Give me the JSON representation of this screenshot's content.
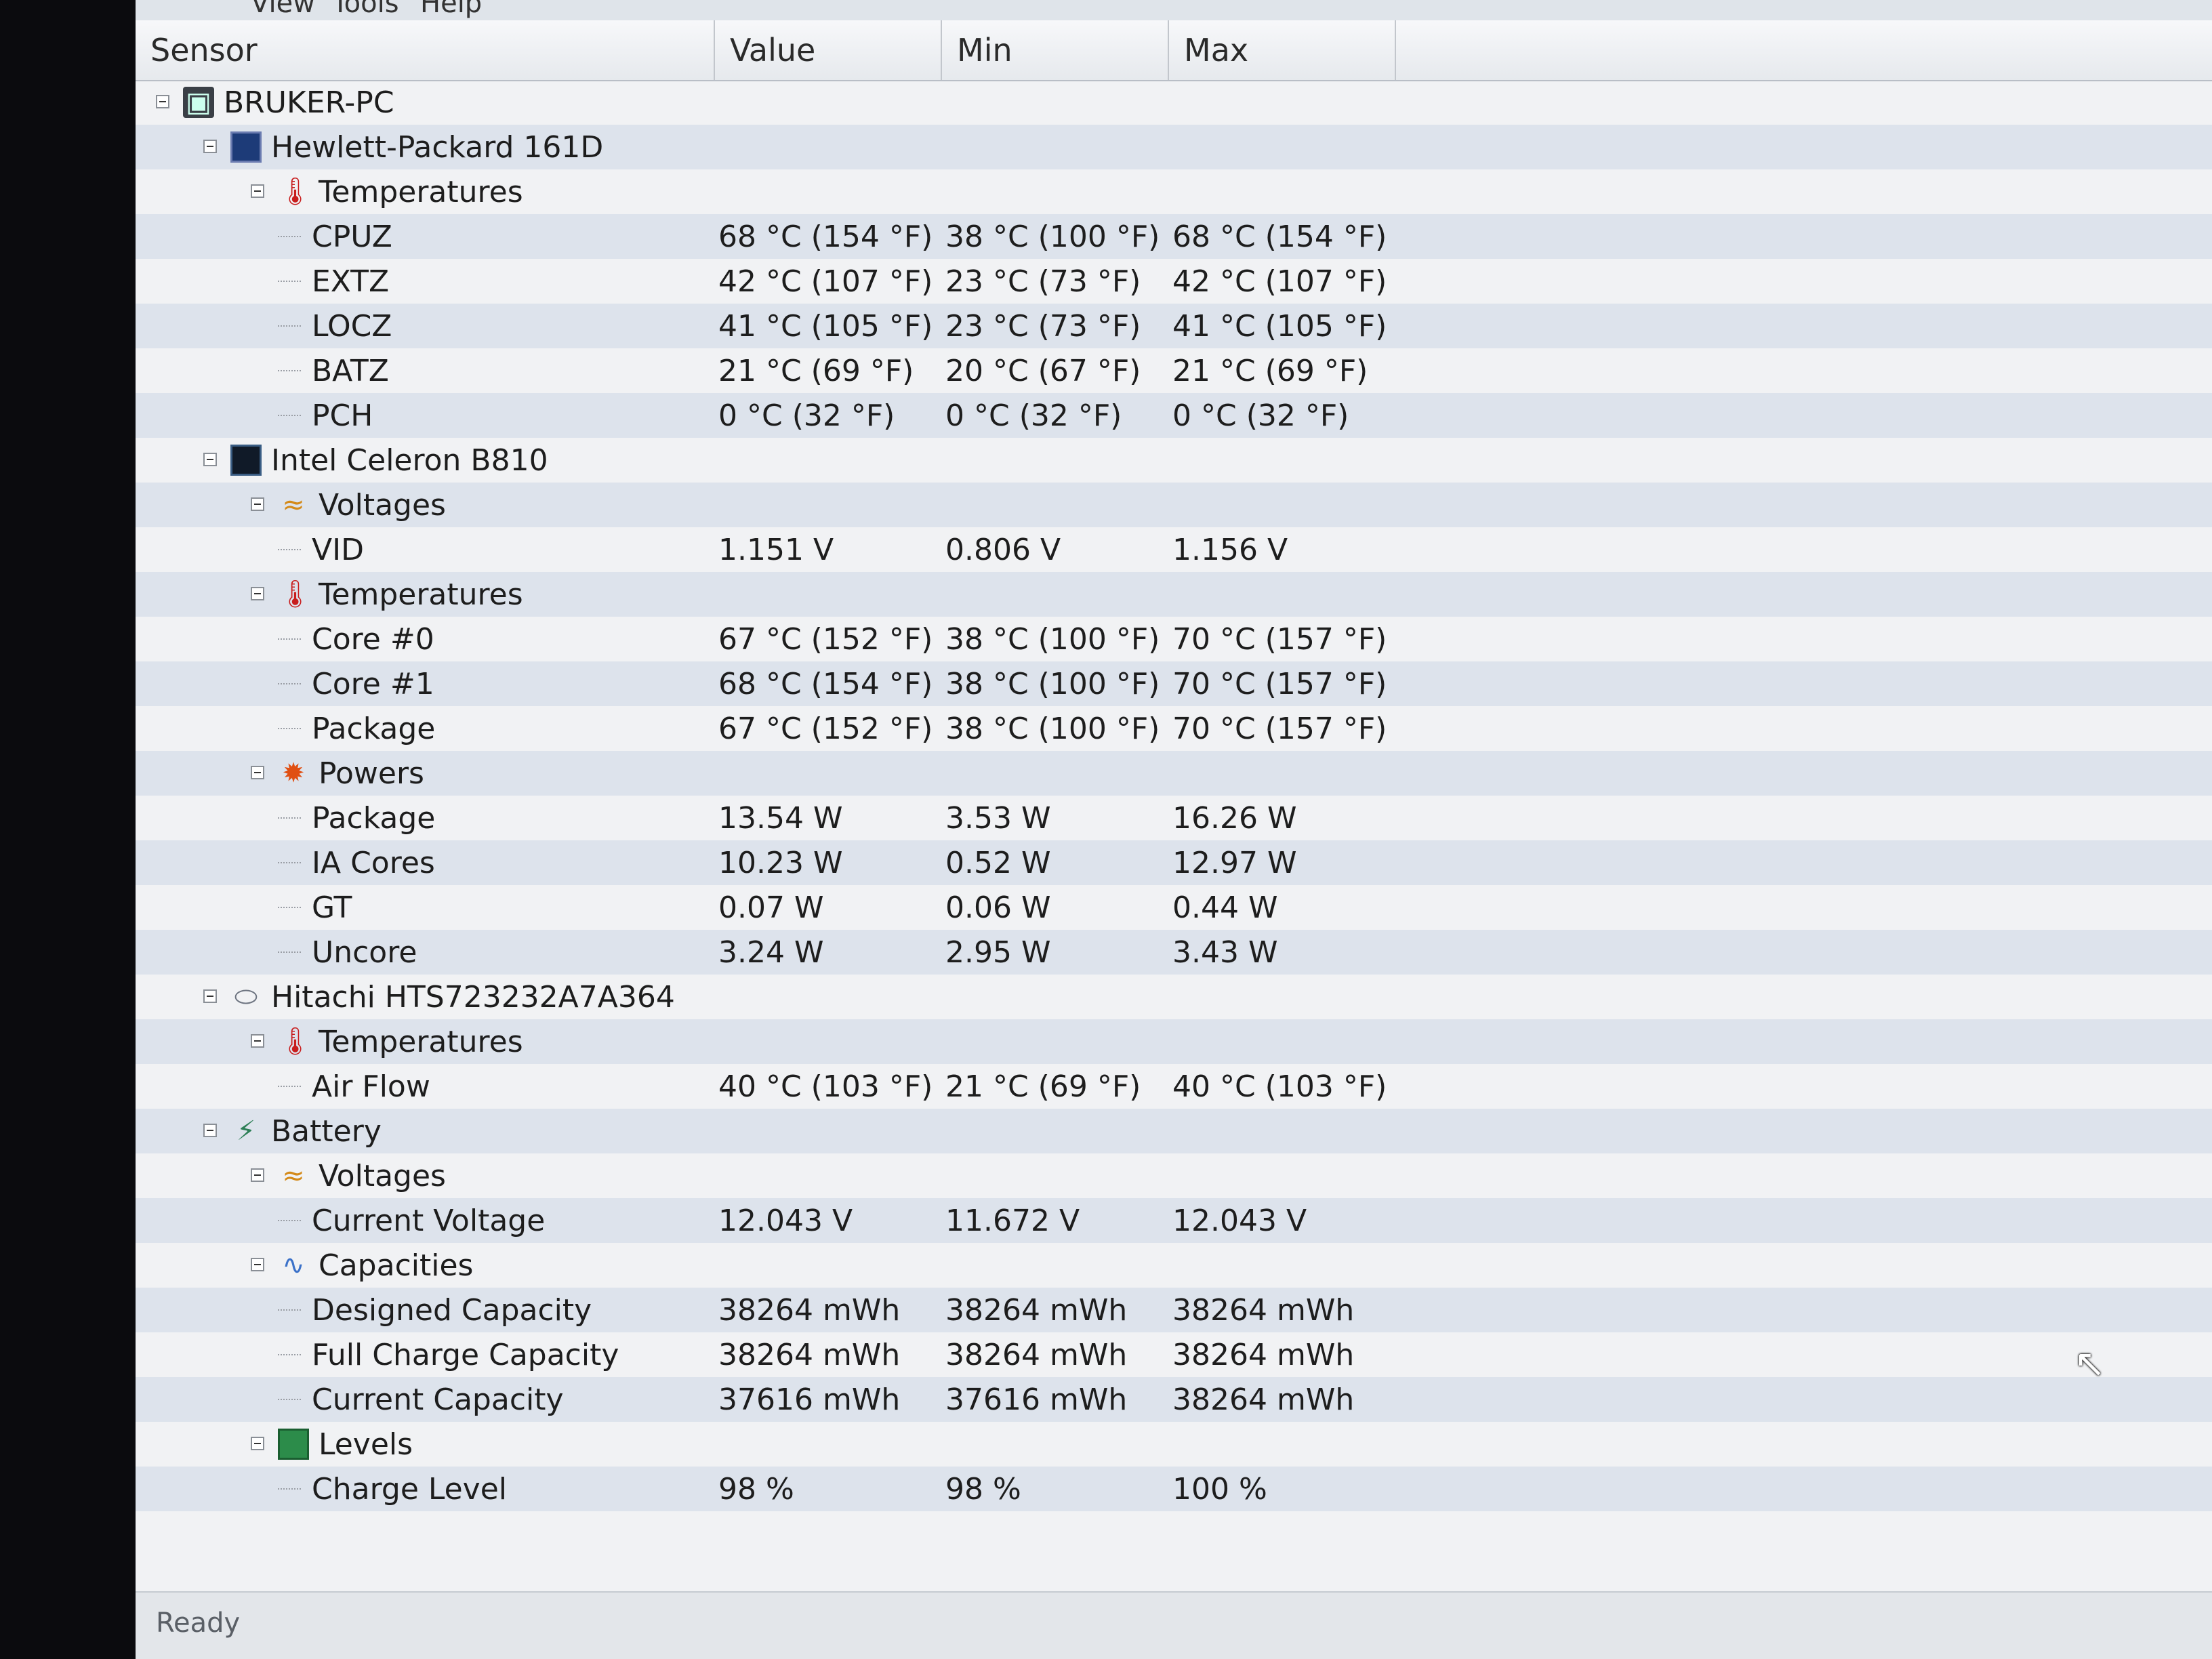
{
  "menu": {
    "view": "View",
    "tools": "Tools",
    "help": "Help"
  },
  "columns": {
    "sensor": "Sensor",
    "value": "Value",
    "min": "Min",
    "max": "Max"
  },
  "tree": [
    {
      "label": "BRUKER-PC",
      "level": 0,
      "icon": "computer-icon",
      "value": "",
      "min": "",
      "max": ""
    },
    {
      "label": "Hewlett-Packard 161D",
      "level": 1,
      "icon": "motherboard-icon",
      "value": "",
      "min": "",
      "max": ""
    },
    {
      "label": "Temperatures",
      "level": 2,
      "icon": "thermometer-icon",
      "value": "",
      "min": "",
      "max": ""
    },
    {
      "label": "CPUZ",
      "level": 3,
      "icon": "",
      "value": "68 °C  (154 °F)",
      "min": "38 °C  (100 °F)",
      "max": "68 °C  (154 °F)"
    },
    {
      "label": "EXTZ",
      "level": 3,
      "icon": "",
      "value": "42 °C  (107 °F)",
      "min": "23 °C  (73 °F)",
      "max": "42 °C  (107 °F)"
    },
    {
      "label": "LOCZ",
      "level": 3,
      "icon": "",
      "value": "41 °C  (105 °F)",
      "min": "23 °C  (73 °F)",
      "max": "41 °C  (105 °F)"
    },
    {
      "label": "BATZ",
      "level": 3,
      "icon": "",
      "value": "21 °C  (69 °F)",
      "min": "20 °C  (67 °F)",
      "max": "21 °C  (69 °F)"
    },
    {
      "label": "PCH",
      "level": 3,
      "icon": "",
      "value": "0 °C  (32 °F)",
      "min": "0 °C  (32 °F)",
      "max": "0 °C  (32 °F)"
    },
    {
      "label": "Intel Celeron B810",
      "level": 1,
      "icon": "cpu-icon",
      "value": "",
      "min": "",
      "max": ""
    },
    {
      "label": "Voltages",
      "level": 2,
      "icon": "voltage-icon",
      "value": "",
      "min": "",
      "max": ""
    },
    {
      "label": "VID",
      "level": 3,
      "icon": "",
      "value": "1.151 V",
      "min": "0.806 V",
      "max": "1.156 V"
    },
    {
      "label": "Temperatures",
      "level": 2,
      "icon": "thermometer-icon",
      "value": "",
      "min": "",
      "max": ""
    },
    {
      "label": "Core #0",
      "level": 3,
      "icon": "",
      "value": "67 °C  (152 °F)",
      "min": "38 °C  (100 °F)",
      "max": "70 °C  (157 °F)"
    },
    {
      "label": "Core #1",
      "level": 3,
      "icon": "",
      "value": "68 °C  (154 °F)",
      "min": "38 °C  (100 °F)",
      "max": "70 °C  (157 °F)"
    },
    {
      "label": "Package",
      "level": 3,
      "icon": "",
      "value": "67 °C  (152 °F)",
      "min": "38 °C  (100 °F)",
      "max": "70 °C  (157 °F)"
    },
    {
      "label": "Powers",
      "level": 2,
      "icon": "power-icon",
      "value": "",
      "min": "",
      "max": ""
    },
    {
      "label": "Package",
      "level": 3,
      "icon": "",
      "value": "13.54 W",
      "min": "3.53 W",
      "max": "16.26 W"
    },
    {
      "label": "IA Cores",
      "level": 3,
      "icon": "",
      "value": "10.23 W",
      "min": "0.52 W",
      "max": "12.97 W"
    },
    {
      "label": "GT",
      "level": 3,
      "icon": "",
      "value": "0.07 W",
      "min": "0.06 W",
      "max": "0.44 W"
    },
    {
      "label": "Uncore",
      "level": 3,
      "icon": "",
      "value": "3.24 W",
      "min": "2.95 W",
      "max": "3.43 W"
    },
    {
      "label": "Hitachi HTS723232A7A364",
      "level": 1,
      "icon": "disk-icon",
      "value": "",
      "min": "",
      "max": ""
    },
    {
      "label": "Temperatures",
      "level": 2,
      "icon": "thermometer-icon",
      "value": "",
      "min": "",
      "max": ""
    },
    {
      "label": "Air Flow",
      "level": 3,
      "icon": "",
      "value": "40 °C  (103 °F)",
      "min": "21 °C  (69 °F)",
      "max": "40 °C  (103 °F)"
    },
    {
      "label": "Battery",
      "level": 1,
      "icon": "battery-icon",
      "value": "",
      "min": "",
      "max": ""
    },
    {
      "label": "Voltages",
      "level": 2,
      "icon": "voltage-icon",
      "value": "",
      "min": "",
      "max": ""
    },
    {
      "label": "Current Voltage",
      "level": 3,
      "icon": "",
      "value": "12.043 V",
      "min": "11.672 V",
      "max": "12.043 V"
    },
    {
      "label": "Capacities",
      "level": 2,
      "icon": "capacity-icon",
      "value": "",
      "min": "",
      "max": ""
    },
    {
      "label": "Designed Capacity",
      "level": 3,
      "icon": "",
      "value": "38264 mWh",
      "min": "38264 mWh",
      "max": "38264 mWh"
    },
    {
      "label": "Full Charge Capacity",
      "level": 3,
      "icon": "",
      "value": "38264 mWh",
      "min": "38264 mWh",
      "max": "38264 mWh"
    },
    {
      "label": "Current Capacity",
      "level": 3,
      "icon": "",
      "value": "37616 mWh",
      "min": "37616 mWh",
      "max": "38264 mWh"
    },
    {
      "label": "Levels",
      "level": 2,
      "icon": "level-icon",
      "value": "",
      "min": "",
      "max": ""
    },
    {
      "label": "Charge Level",
      "level": 3,
      "icon": "",
      "value": "98 %",
      "min": "98 %",
      "max": "100 %"
    }
  ],
  "status": {
    "text": "Ready"
  }
}
